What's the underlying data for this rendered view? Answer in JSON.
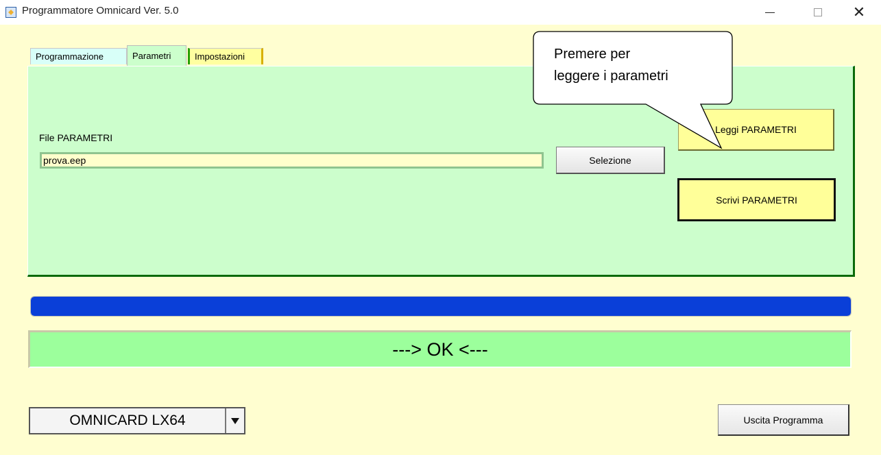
{
  "window": {
    "title": "Programmatore Omnicard Ver. 5.0",
    "minimize": "minimize",
    "maximize": "maximize",
    "close": "close"
  },
  "tabs": [
    {
      "label": "Programmazione",
      "active": false
    },
    {
      "label": "Parametri",
      "active": true
    },
    {
      "label": "Impostazioni",
      "active": false
    }
  ],
  "parametri": {
    "file_label": "File PARAMETRI",
    "file_value": "prova.eep",
    "selezione_label": "Selezione",
    "leggi_label": "Leggi PARAMETRI",
    "scrivi_label": "Scrivi PARAMETRI",
    "callout_line1": "Premere per",
    "callout_line2": "leggere i parametri"
  },
  "progress": {
    "percent": 100,
    "color": "#0a3fd8"
  },
  "status": {
    "text": "---> OK <---",
    "color": "#9cff9c"
  },
  "model": {
    "selected": "OMNICARD LX64"
  },
  "exit_label": "Uscita Programma",
  "colors": {
    "background": "#fffed0",
    "panel": "#ccfecc",
    "button_yellow": "#ffff99"
  },
  "icons": {
    "app": "app-icon",
    "dropdown": "chevron-down-icon"
  }
}
